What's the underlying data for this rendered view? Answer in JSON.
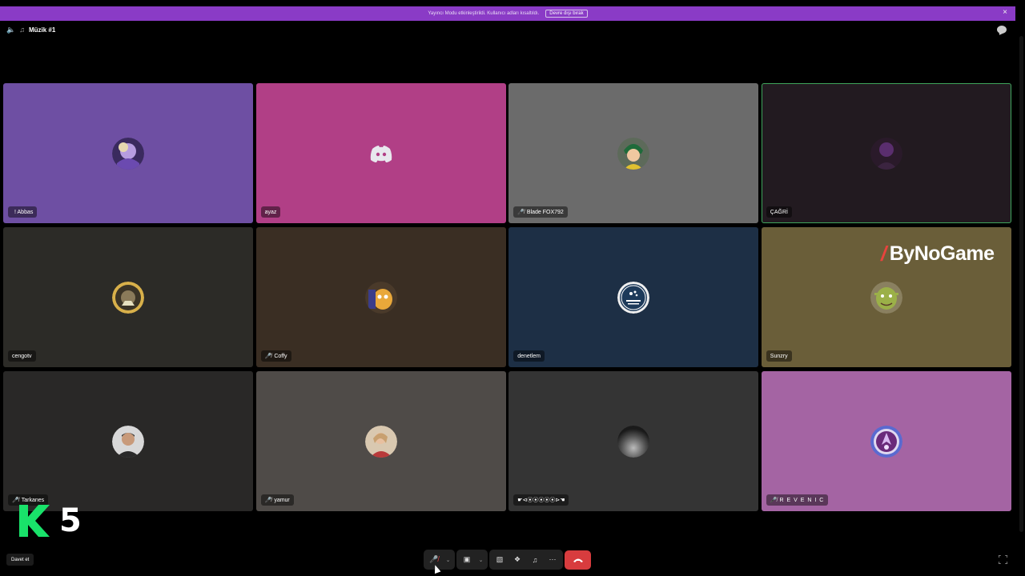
{
  "banner": {
    "text": "Yayıncı Modu etkinleştirildi. Kullanıcı adları kısaltıldı.",
    "button_label": "Devre dışı bırak",
    "close_label": "×"
  },
  "header": {
    "channel_name": "Müzik #1",
    "speaker_icon": "speaker-icon",
    "music_icon": "music-channel-icon"
  },
  "participants": [
    {
      "name": "! Abbas",
      "muted": false,
      "bg": "#6e4fa3",
      "avatar": "anime-purple-avatar"
    },
    {
      "name": "ayaz",
      "muted": false,
      "bg": "#b13f86",
      "avatar": "discord-default-avatar"
    },
    {
      "name": "Blade FOX792",
      "muted": true,
      "bg": "#6b6b6b",
      "avatar": "green-hair-hero-avatar"
    },
    {
      "name": "ÇAĞRİ",
      "muted": false,
      "bg": "#221a20",
      "avatar": "dark-figure-avatar",
      "speaking": true
    },
    {
      "name": "cengotv",
      "muted": false,
      "bg": "#2c2b27",
      "avatar": "gold-badge-avatar"
    },
    {
      "name": "Coffy",
      "muted": true,
      "bg": "#3a2e23",
      "avatar": "jake-dog-avatar"
    },
    {
      "name": "denetlem",
      "muted": false,
      "bg": "#1d2f45",
      "avatar": "subaru-logo-avatar"
    },
    {
      "name": "Sunzry",
      "muted": false,
      "bg": "#6a5e39",
      "avatar": "shrek-avatar"
    },
    {
      "name": "Tarkanes",
      "muted": true,
      "bg": "#292827",
      "avatar": "man-portrait-avatar"
    },
    {
      "name": "yamur",
      "muted": true,
      "bg": "#4f4b48",
      "avatar": "girl-portrait-avatar"
    },
    {
      "name": "☛⊲⦿⦿⦿⦿⦿⊳☚",
      "muted": false,
      "bg": "#343434",
      "avatar": "dark-sphere-avatar"
    },
    {
      "name": "R E V E N I C",
      "muted": true,
      "bg": "#a464a3",
      "avatar": "purple-emblem-avatar"
    }
  ],
  "watermarks": {
    "bynogame": "ByNoGame",
    "channel_number": "5"
  },
  "footer": {
    "invite_label": "Davet et"
  },
  "colors": {
    "banner": "#8a3bc6",
    "hangup": "#d83c3e",
    "speaking_outline": "#3fa55c",
    "muted_mic": "#ed4245"
  }
}
